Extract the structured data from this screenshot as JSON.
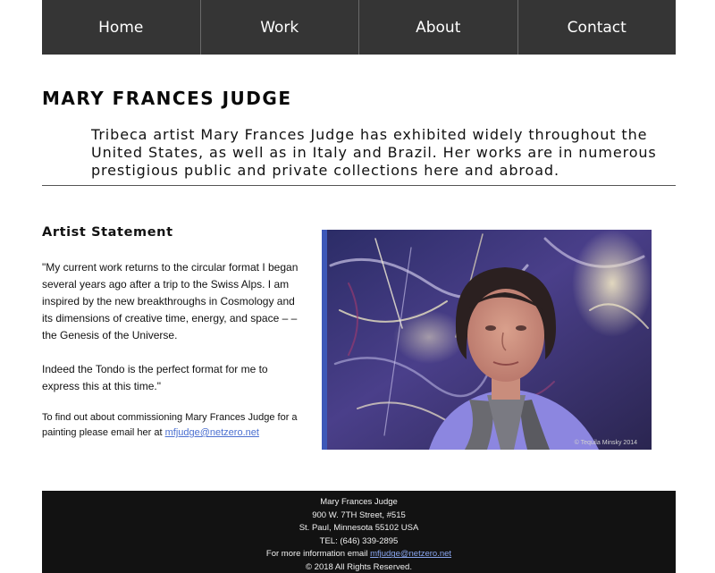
{
  "nav": {
    "items": [
      {
        "label": "Home"
      },
      {
        "label": "Work"
      },
      {
        "label": "About"
      },
      {
        "label": "Contact"
      }
    ]
  },
  "header": {
    "title": "MARY FRANCES JUDGE",
    "intro": "Tribeca artist Mary Frances Judge has exhibited widely throughout the United States, as well as in Italy and Brazil. Her works are in numerous prestigious public and private collections here and abroad."
  },
  "statement": {
    "heading": "Artist Statement",
    "paragraph1": "\"My current work returns to the circular format I began several years ago after a trip to the Swiss Alps. I am inspired by the new breakthroughs in Cosmology and its dimensions of creative time, energy, and space – – the Genesis of the Universe.",
    "paragraph2": "Indeed the Tondo is the perfect format for me to express this at this time.\"",
    "commission_text": "To find out about commissioning Mary Frances Judge for a painting please email her at ",
    "email": "mfjudge@netzero.net"
  },
  "photo": {
    "credit": "© Tequila Minsky 2014"
  },
  "footer": {
    "name": "Mary Frances Judge",
    "street": "900 W. 7TH Street, #515",
    "city": "St. Paul, Minnesota 55102 USA",
    "phone": "TEL: (646) 339-2895",
    "info_text": "For more information email ",
    "email": "mfjudge@netzero.net",
    "copyright": "© 2018 All Rights Reserved."
  }
}
